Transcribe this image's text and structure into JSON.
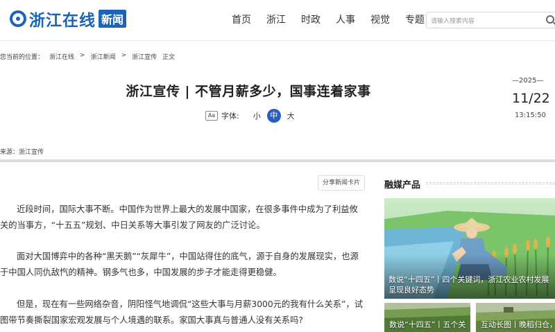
{
  "header": {
    "logo_text": "浙江在线",
    "logo_badge": "新闻",
    "nav": [
      "首页",
      "浙江",
      "时政",
      "人事",
      "视觉",
      "专题"
    ],
    "search_placeholder": "请输入搜索内容",
    "search_icon": "search-icon"
  },
  "breadcrumb": [
    "您当前的位置：",
    "浙江在线",
    ">",
    "浙江新闻",
    ">",
    "浙江宣传",
    "正文"
  ],
  "article": {
    "title": "浙江宣传 | 不管月薪多少，国事连着家事",
    "font_label": "字体:",
    "font_sizes": {
      "small": "小",
      "medium": "中",
      "large": "大"
    },
    "font_icon_text": "Aa",
    "date_year": "—2025—",
    "date_day": "11/22",
    "date_time": "13:15:50",
    "source": "来源：浙江宣传",
    "share_label": "分享新闻卡片",
    "paragraphs": [
      "近段时间，国际大事不断。中国作为世界上最大的发展中国家，在很多事件中成为了利益攸关的当事方，“十五五”规划、中日关系等大事引发了网友的广泛讨论。",
      "面对大国博弈中的各种“黑天鹅”“灰犀牛”，中国站得住的底气，源于自身的发展现实，也源于中国人同仇敌忾的精神。钢多气也多，中国发展的步子才能走得更稳健。",
      "但是，现在有一些网络杂音，阴阳怪气地调侃“这些大事与月薪3000元的我有什么关系”，试图带节奏撕裂国家宏观发展与个人境遇的联系。家国大事真与普通人没有关系吗?"
    ]
  },
  "sidebar": {
    "title": "融媒产品",
    "feature_caption": "数说“十四五”丨四个关键词，浙江农业农村发展呈现良好态势",
    "thumbs": [
      "数说“十四五”丨五个关",
      "互动长图丨晚稻归仓，"
    ]
  },
  "colors": {
    "brand": "#1b64b8",
    "accent": "#2a5fc1"
  }
}
